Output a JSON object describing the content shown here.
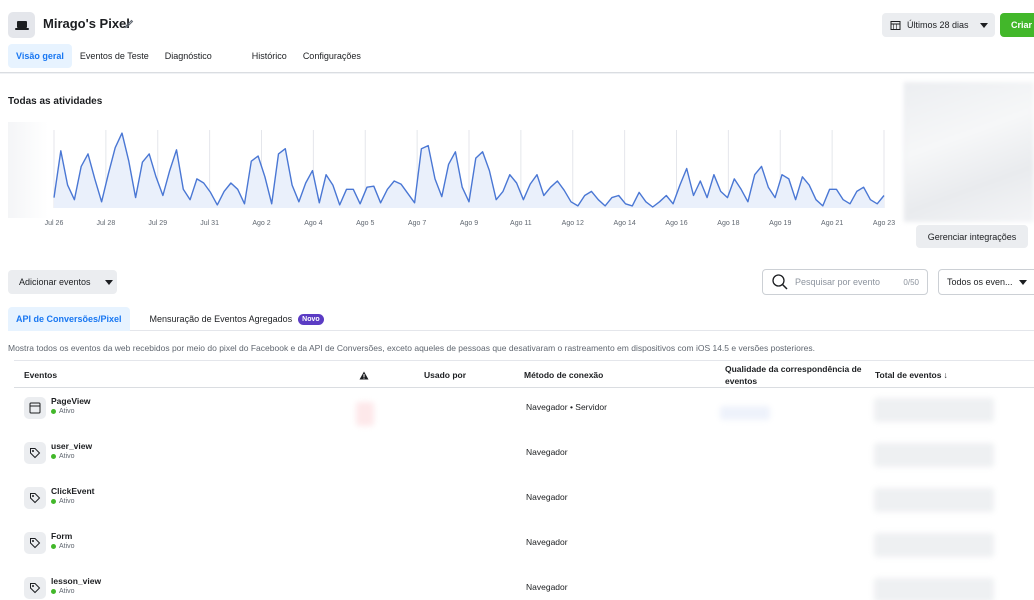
{
  "header": {
    "title": "Mirago's Pixel",
    "date_range": "Últimos 28 dias",
    "create_label": "Criar",
    "tabs": [
      "Visão geral",
      "Eventos de Teste",
      "Diagnóstico",
      "Histórico",
      "Configurações"
    ]
  },
  "activity": {
    "title": "Todas as atividades",
    "manage_integrations": "Gerenciar integrações"
  },
  "chart_data": {
    "type": "line",
    "x_tick_labels": [
      "Jul 26",
      "Jul 28",
      "Jul 29",
      "Jul 31",
      "Ago 2",
      "Ago 4",
      "Ago 5",
      "Ago 7",
      "Ago 9",
      "Ago 11",
      "Ago 12",
      "Ago 14",
      "Ago 16",
      "Ago 18",
      "Ago 19",
      "Ago 21",
      "Ago 23"
    ],
    "series": [
      {
        "values": [
          10,
          55,
          22,
          8,
          40,
          52,
          28,
          6,
          33,
          58,
          72,
          45,
          10,
          44,
          52,
          30,
          12,
          36,
          56,
          18,
          8,
          28,
          24,
          15,
          3,
          16,
          24,
          18,
          4,
          45,
          50,
          30,
          4,
          52,
          57,
          22,
          6,
          24,
          36,
          5,
          32,
          22,
          3,
          18,
          18,
          4,
          20,
          21,
          5,
          18,
          26,
          23,
          14,
          5,
          57,
          60,
          28,
          11,
          42,
          54,
          20,
          6,
          48,
          54,
          36,
          8,
          16,
          32,
          24,
          8,
          23,
          32,
          12,
          20,
          26,
          17,
          6,
          2,
          12,
          16,
          8,
          2,
          10,
          12,
          4,
          2,
          15,
          6,
          1,
          6,
          12,
          4,
          22,
          38,
          12,
          26,
          10,
          32,
          16,
          10,
          28,
          18,
          6,
          32,
          40,
          20,
          10,
          32,
          28,
          8,
          30,
          22,
          8,
          2,
          18,
          18,
          8,
          4,
          16,
          20,
          8,
          4,
          12
        ]
      }
    ],
    "grid": "vertical",
    "color": "#4a77d4"
  },
  "toolbar": {
    "add_events": "Adicionar eventos",
    "search_placeholder": "Pesquisar por evento",
    "search_counter": "0/50",
    "filter_label": "Todos os even..."
  },
  "subtabs": {
    "active": "API de Conversões/Pixel",
    "other": "Mensuração de Eventos Agregados",
    "badge": "Novo"
  },
  "description": "Mostra todos os eventos da web recebidos por meio do pixel do Facebook e da API de Conversões, exceto aqueles de pessoas que desativaram o rastreamento em dispositivos com iOS 14.5 e versões posteriores.",
  "table": {
    "headers": {
      "events": "Eventos",
      "used_by": "Usado por",
      "connection": "Método de conexão",
      "quality": "Qualidade da correspondência de eventos",
      "total": "Total de eventos"
    },
    "rows": [
      {
        "name": "PageView",
        "status": "Ativo",
        "method": "Navegador • Servidor",
        "icon": "browser-window-icon"
      },
      {
        "name": "user_view",
        "status": "Ativo",
        "method": "Navegador",
        "icon": "tag-icon"
      },
      {
        "name": "ClickEvent",
        "status": "Ativo",
        "method": "Navegador",
        "icon": "tag-icon"
      },
      {
        "name": "Form",
        "status": "Ativo",
        "method": "Navegador",
        "icon": "tag-icon"
      },
      {
        "name": "lesson_view",
        "status": "Ativo",
        "method": "Navegador",
        "icon": "tag-icon"
      }
    ]
  },
  "colors": {
    "accent": "#1877f2",
    "create": "#42b72a",
    "badge": "#5b3cc4",
    "line": "#4a77d4"
  }
}
